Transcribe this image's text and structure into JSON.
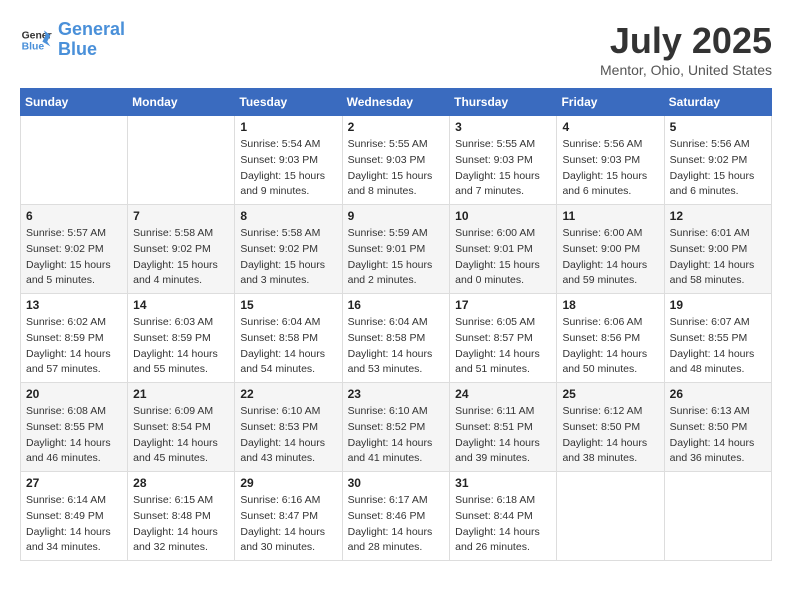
{
  "header": {
    "logo_line1": "General",
    "logo_line2": "Blue",
    "month_title": "July 2025",
    "location": "Mentor, Ohio, United States"
  },
  "days_of_week": [
    "Sunday",
    "Monday",
    "Tuesday",
    "Wednesday",
    "Thursday",
    "Friday",
    "Saturday"
  ],
  "weeks": [
    [
      {
        "day": "",
        "info": ""
      },
      {
        "day": "",
        "info": ""
      },
      {
        "day": "1",
        "info": "Sunrise: 5:54 AM\nSunset: 9:03 PM\nDaylight: 15 hours\nand 9 minutes."
      },
      {
        "day": "2",
        "info": "Sunrise: 5:55 AM\nSunset: 9:03 PM\nDaylight: 15 hours\nand 8 minutes."
      },
      {
        "day": "3",
        "info": "Sunrise: 5:55 AM\nSunset: 9:03 PM\nDaylight: 15 hours\nand 7 minutes."
      },
      {
        "day": "4",
        "info": "Sunrise: 5:56 AM\nSunset: 9:03 PM\nDaylight: 15 hours\nand 6 minutes."
      },
      {
        "day": "5",
        "info": "Sunrise: 5:56 AM\nSunset: 9:02 PM\nDaylight: 15 hours\nand 6 minutes."
      }
    ],
    [
      {
        "day": "6",
        "info": "Sunrise: 5:57 AM\nSunset: 9:02 PM\nDaylight: 15 hours\nand 5 minutes."
      },
      {
        "day": "7",
        "info": "Sunrise: 5:58 AM\nSunset: 9:02 PM\nDaylight: 15 hours\nand 4 minutes."
      },
      {
        "day": "8",
        "info": "Sunrise: 5:58 AM\nSunset: 9:02 PM\nDaylight: 15 hours\nand 3 minutes."
      },
      {
        "day": "9",
        "info": "Sunrise: 5:59 AM\nSunset: 9:01 PM\nDaylight: 15 hours\nand 2 minutes."
      },
      {
        "day": "10",
        "info": "Sunrise: 6:00 AM\nSunset: 9:01 PM\nDaylight: 15 hours\nand 0 minutes."
      },
      {
        "day": "11",
        "info": "Sunrise: 6:00 AM\nSunset: 9:00 PM\nDaylight: 14 hours\nand 59 minutes."
      },
      {
        "day": "12",
        "info": "Sunrise: 6:01 AM\nSunset: 9:00 PM\nDaylight: 14 hours\nand 58 minutes."
      }
    ],
    [
      {
        "day": "13",
        "info": "Sunrise: 6:02 AM\nSunset: 8:59 PM\nDaylight: 14 hours\nand 57 minutes."
      },
      {
        "day": "14",
        "info": "Sunrise: 6:03 AM\nSunset: 8:59 PM\nDaylight: 14 hours\nand 55 minutes."
      },
      {
        "day": "15",
        "info": "Sunrise: 6:04 AM\nSunset: 8:58 PM\nDaylight: 14 hours\nand 54 minutes."
      },
      {
        "day": "16",
        "info": "Sunrise: 6:04 AM\nSunset: 8:58 PM\nDaylight: 14 hours\nand 53 minutes."
      },
      {
        "day": "17",
        "info": "Sunrise: 6:05 AM\nSunset: 8:57 PM\nDaylight: 14 hours\nand 51 minutes."
      },
      {
        "day": "18",
        "info": "Sunrise: 6:06 AM\nSunset: 8:56 PM\nDaylight: 14 hours\nand 50 minutes."
      },
      {
        "day": "19",
        "info": "Sunrise: 6:07 AM\nSunset: 8:55 PM\nDaylight: 14 hours\nand 48 minutes."
      }
    ],
    [
      {
        "day": "20",
        "info": "Sunrise: 6:08 AM\nSunset: 8:55 PM\nDaylight: 14 hours\nand 46 minutes."
      },
      {
        "day": "21",
        "info": "Sunrise: 6:09 AM\nSunset: 8:54 PM\nDaylight: 14 hours\nand 45 minutes."
      },
      {
        "day": "22",
        "info": "Sunrise: 6:10 AM\nSunset: 8:53 PM\nDaylight: 14 hours\nand 43 minutes."
      },
      {
        "day": "23",
        "info": "Sunrise: 6:10 AM\nSunset: 8:52 PM\nDaylight: 14 hours\nand 41 minutes."
      },
      {
        "day": "24",
        "info": "Sunrise: 6:11 AM\nSunset: 8:51 PM\nDaylight: 14 hours\nand 39 minutes."
      },
      {
        "day": "25",
        "info": "Sunrise: 6:12 AM\nSunset: 8:50 PM\nDaylight: 14 hours\nand 38 minutes."
      },
      {
        "day": "26",
        "info": "Sunrise: 6:13 AM\nSunset: 8:50 PM\nDaylight: 14 hours\nand 36 minutes."
      }
    ],
    [
      {
        "day": "27",
        "info": "Sunrise: 6:14 AM\nSunset: 8:49 PM\nDaylight: 14 hours\nand 34 minutes."
      },
      {
        "day": "28",
        "info": "Sunrise: 6:15 AM\nSunset: 8:48 PM\nDaylight: 14 hours\nand 32 minutes."
      },
      {
        "day": "29",
        "info": "Sunrise: 6:16 AM\nSunset: 8:47 PM\nDaylight: 14 hours\nand 30 minutes."
      },
      {
        "day": "30",
        "info": "Sunrise: 6:17 AM\nSunset: 8:46 PM\nDaylight: 14 hours\nand 28 minutes."
      },
      {
        "day": "31",
        "info": "Sunrise: 6:18 AM\nSunset: 8:44 PM\nDaylight: 14 hours\nand 26 minutes."
      },
      {
        "day": "",
        "info": ""
      },
      {
        "day": "",
        "info": ""
      }
    ]
  ]
}
